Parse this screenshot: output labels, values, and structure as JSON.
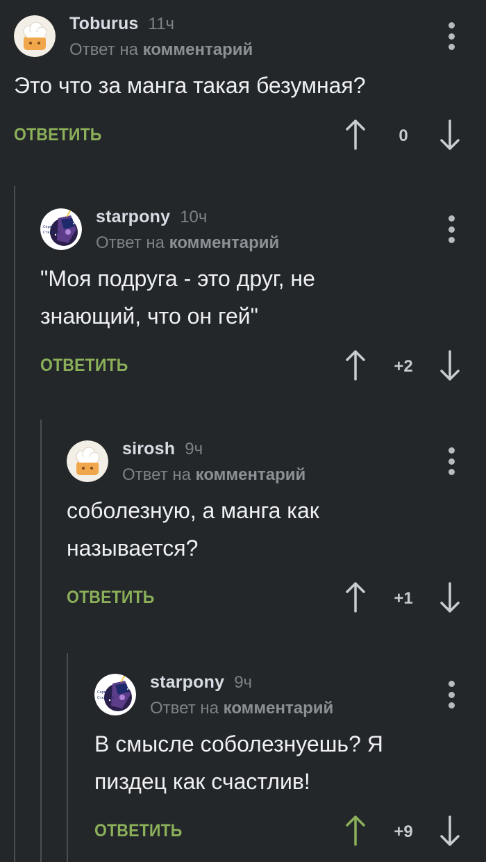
{
  "colors": {
    "background": "#24272a",
    "reply_green": "#8bb059",
    "arrow_default": "#c9ccd0",
    "arrow_upvoted": "#8bb059",
    "thread_line": "#4a4e52"
  },
  "comments": [
    {
      "author": "Toburus",
      "time": "11ч",
      "reply_prefix": "Ответ на",
      "reply_target": "комментарий",
      "text_lines": [
        "Это что за манга такая безумная?"
      ],
      "reply_label": "ОТВЕТИТЬ",
      "score": "0",
      "avatar": "chef-hat-avatar-icon",
      "upvoted": false
    },
    {
      "author": "starpony",
      "time": "10ч",
      "reply_prefix": "Ответ на",
      "reply_target": "комментарий",
      "text_lines": [
        "\"Моя подруга - это друг, не",
        "знающий, что он гей\""
      ],
      "reply_label": "ОТВЕТИТЬ",
      "score": "+2",
      "avatar": "pony-avatar-icon",
      "upvoted": false
    },
    {
      "author": "sirosh",
      "time": "9ч",
      "reply_prefix": "Ответ на",
      "reply_target": "комментарий",
      "text_lines": [
        "соболезную, а манга как",
        "называется?"
      ],
      "reply_label": "ОТВЕТИТЬ",
      "score": "+1",
      "avatar": "chef-hat-avatar-icon",
      "upvoted": false
    },
    {
      "author": "starpony",
      "time": "9ч",
      "reply_prefix": "Ответ на",
      "reply_target": "комментарий",
      "text_lines": [
        "В смысле соболезнуешь? Я",
        "пиздец как счастлив!"
      ],
      "reply_label": "ОТВЕТИТЬ",
      "score": "+9",
      "avatar": "pony-avatar-icon",
      "upvoted": true
    }
  ]
}
